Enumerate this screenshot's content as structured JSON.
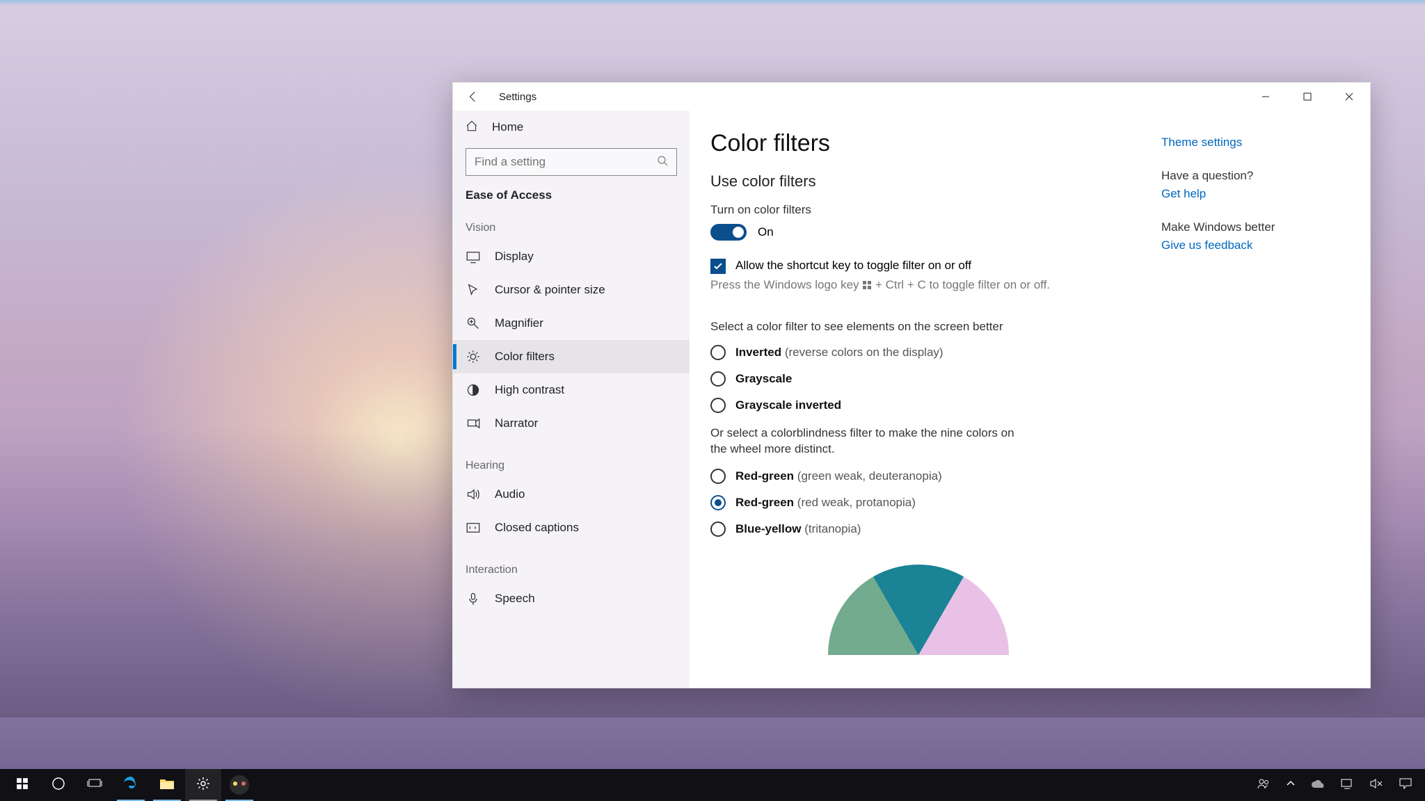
{
  "window": {
    "title": "Settings",
    "home": "Home",
    "search_placeholder": "Find a setting",
    "category": "Ease of Access"
  },
  "groups": {
    "vision": "Vision",
    "hearing": "Hearing",
    "interaction": "Interaction"
  },
  "nav": {
    "display": "Display",
    "cursor": "Cursor & pointer size",
    "magnifier": "Magnifier",
    "colorfilters": "Color filters",
    "highcontrast": "High contrast",
    "narrator": "Narrator",
    "audio": "Audio",
    "closedcaptions": "Closed captions",
    "speech": "Speech"
  },
  "page": {
    "h1": "Color filters",
    "h2": "Use color filters",
    "toggle_label": "Turn on color filters",
    "toggle_state": "On",
    "chk_label": "Allow the shortcut key to toggle filter on or off",
    "chk_hint_pre": "Press the Windows logo key ",
    "chk_hint_post": " + Ctrl + C to toggle filter on or off.",
    "select_label": "Select a color filter to see elements on the screen better",
    "radios": {
      "inverted_b": "Inverted",
      "inverted_s": " (reverse colors on the display)",
      "grayscale": "Grayscale",
      "grayinv": "Grayscale inverted",
      "cb_intro": "Or select a colorblindness filter to make the nine colors on the wheel more distinct.",
      "rg1_b": "Red-green",
      "rg1_s": " (green weak, deuteranopia)",
      "rg2_b": "Red-green",
      "rg2_s": " (red weak, protanopia)",
      "by_b": "Blue-yellow",
      "by_s": " (tritanopia)"
    }
  },
  "aside": {
    "theme_link": "Theme settings",
    "question": "Have a question?",
    "help_link": "Get help",
    "better": "Make Windows better",
    "feedback_link": "Give us feedback"
  }
}
